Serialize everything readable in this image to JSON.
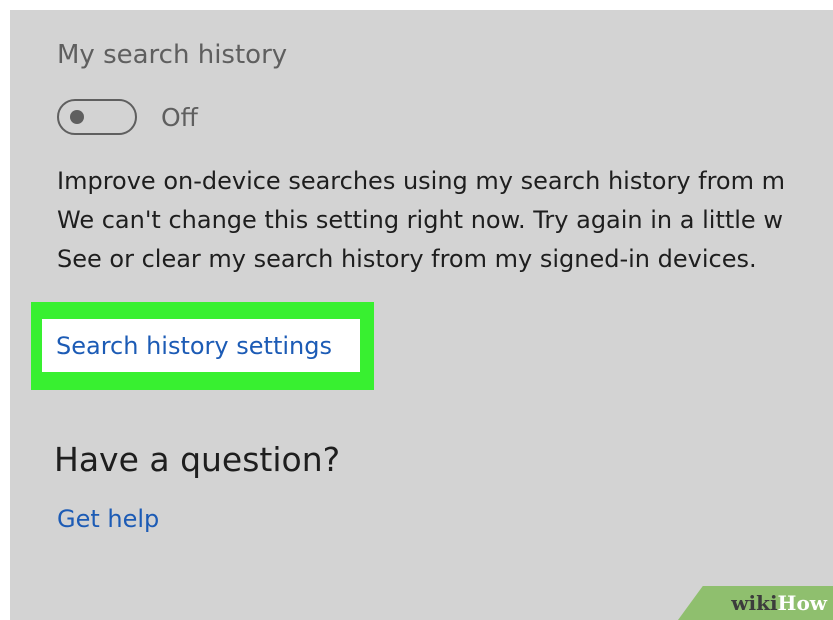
{
  "search_history": {
    "title": "My search history",
    "toggle_state": "Off",
    "toggle_on": false
  },
  "description": {
    "lines": [
      "Improve on-device searches using my search history from m",
      "We can't change this setting right now. Try again in a little w",
      "See or clear my search history from my signed-in devices."
    ]
  },
  "links": {
    "search_history_settings": "Search history settings",
    "get_help": "Get help"
  },
  "help": {
    "heading": "Have a question?"
  },
  "watermark": {
    "wiki": "wiki",
    "how": "How"
  },
  "colors": {
    "background": "#d3d3d3",
    "link": "#1c5bb5",
    "highlight": "#38f030",
    "watermark_bg": "#8fbf6e"
  }
}
